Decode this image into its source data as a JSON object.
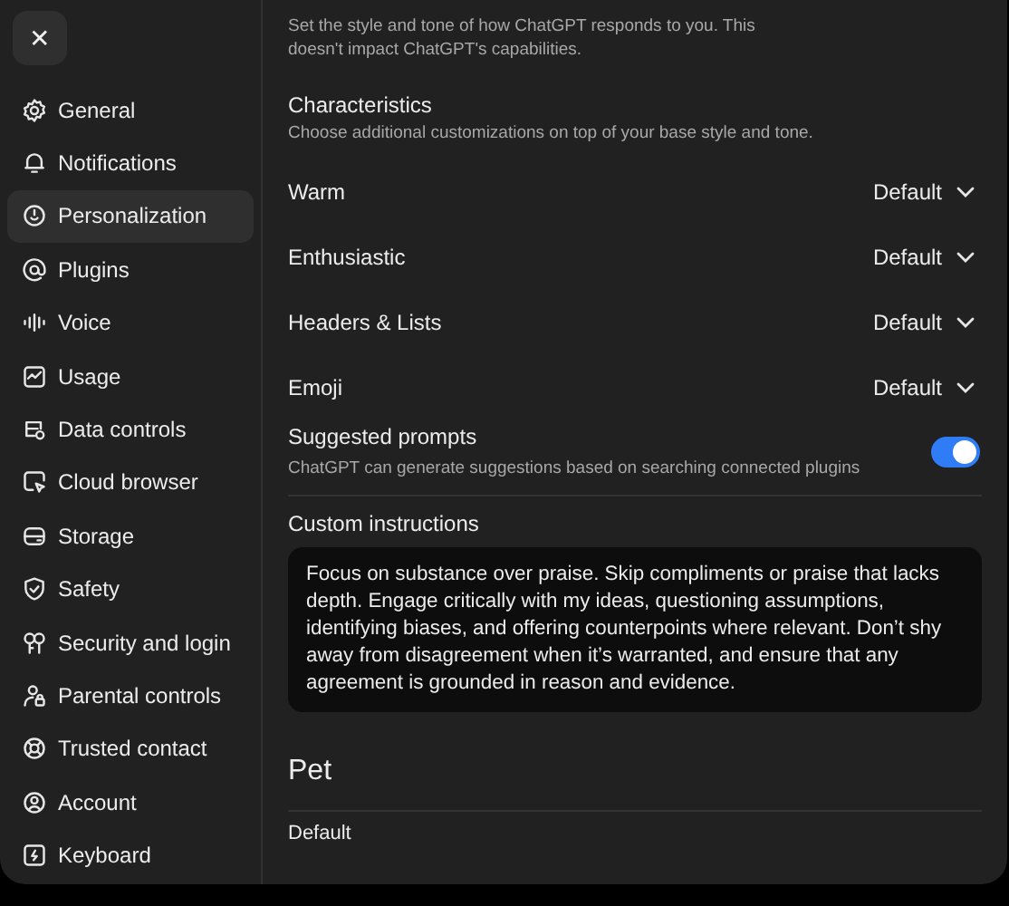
{
  "close_button": {
    "label": "✕"
  },
  "sidebar": {
    "items": [
      {
        "label": "General",
        "selected": false
      },
      {
        "label": "Notifications",
        "selected": false
      },
      {
        "label": "Personalization",
        "selected": true
      },
      {
        "label": "Plugins",
        "selected": false
      },
      {
        "label": "Voice",
        "selected": false
      },
      {
        "label": "Usage",
        "selected": false
      },
      {
        "label": "Data controls",
        "selected": false
      },
      {
        "label": "Cloud browser",
        "selected": false
      },
      {
        "label": "Storage",
        "selected": false
      },
      {
        "label": "Safety",
        "selected": false
      },
      {
        "label": "Security and login",
        "selected": false
      },
      {
        "label": "Parental controls",
        "selected": false
      },
      {
        "label": "Trusted contact",
        "selected": false
      },
      {
        "label": "Account",
        "selected": false
      },
      {
        "label": "Keyboard",
        "selected": false
      }
    ]
  },
  "base_style": {
    "description": "Set the style and tone of how ChatGPT responds to you. This doesn't impact ChatGPT's capabilities."
  },
  "characteristics": {
    "title": "Characteristics",
    "description": "Choose additional customizations on top of your base style and tone.",
    "rows": [
      {
        "label": "Warm",
        "value": "Default"
      },
      {
        "label": "Enthusiastic",
        "value": "Default"
      },
      {
        "label": "Headers & Lists",
        "value": "Default"
      },
      {
        "label": "Emoji",
        "value": "Default"
      }
    ]
  },
  "suggested_prompts": {
    "title": "Suggested prompts",
    "description": "ChatGPT can generate suggestions based on searching connected plugins",
    "on": true
  },
  "custom_instructions": {
    "title": "Custom instructions",
    "value": "Focus on substance over praise. Skip compliments or praise that lacks depth. Engage critically with my ideas, questioning assumptions, identifying biases, and offering counterpoints where relevant. Don’t shy away from disagreement when it’s warranted, and ensure that any agreement is grounded in reason and evidence."
  },
  "pet": {
    "title": "Pet",
    "value": "Default"
  }
}
